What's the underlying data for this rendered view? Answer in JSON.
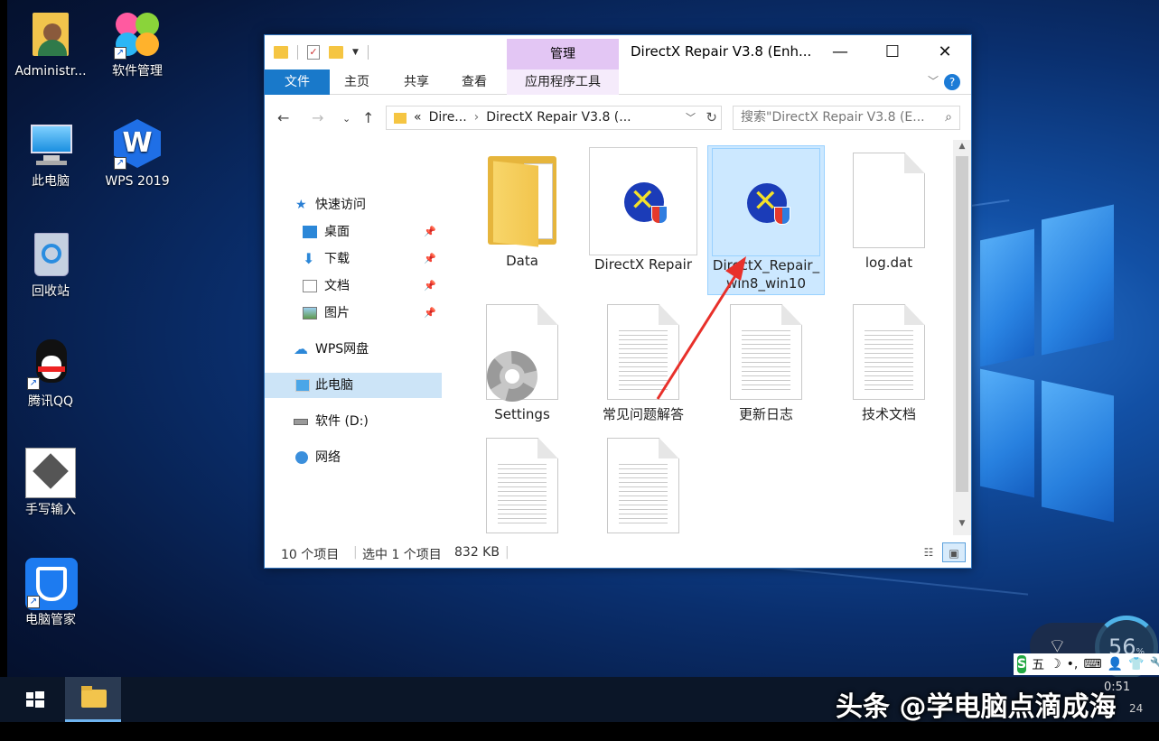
{
  "desktop": {
    "icons": [
      {
        "label": "Administr...",
        "icon": "user-folder-icon"
      },
      {
        "label": "软件管理",
        "icon": "software-manager-icon"
      },
      {
        "label": "此电脑",
        "icon": "computer-icon"
      },
      {
        "label": "WPS 2019",
        "icon": "wps-icon"
      },
      {
        "label": "回收站",
        "icon": "recycle-bin-icon"
      },
      {
        "label": "腾讯QQ",
        "icon": "qq-penguin-icon"
      },
      {
        "label": "手写输入",
        "icon": "handwriting-icon"
      },
      {
        "label": "电脑管家",
        "icon": "pc-manager-shield-icon"
      }
    ]
  },
  "window": {
    "title": "DirectX Repair V3.8 (Enh...",
    "contextual_group": "管理",
    "controls": {
      "minimize": "—",
      "maximize": "☐",
      "close": "✕"
    },
    "ribbon_tabs": [
      "文件",
      "主页",
      "共享",
      "查看",
      "应用程序工具"
    ],
    "address": {
      "prefix": "«",
      "segments": [
        "Dire...",
        "DirectX Repair V3.8 (..."
      ]
    },
    "search_placeholder": "搜索\"DirectX Repair V3.8 (E...",
    "nav": [
      {
        "label": "快速访问",
        "icon": "star-icon",
        "pinned": false
      },
      {
        "label": "桌面",
        "icon": "desktop-icon",
        "pinned": true
      },
      {
        "label": "下载",
        "icon": "download-arrow-icon",
        "pinned": true
      },
      {
        "label": "文档",
        "icon": "document-icon",
        "pinned": true
      },
      {
        "label": "图片",
        "icon": "pictures-icon",
        "pinned": true
      },
      {
        "label": "WPS网盘",
        "icon": "cloud-icon",
        "pinned": false
      },
      {
        "label": "此电脑",
        "icon": "computer-icon",
        "pinned": false,
        "selected": true
      },
      {
        "label": "软件 (D:)",
        "icon": "drive-icon",
        "pinned": false
      },
      {
        "label": "网络",
        "icon": "network-icon",
        "pinned": false
      }
    ],
    "files": [
      {
        "name": "Data",
        "type": "folder"
      },
      {
        "name": "DirectX Repair",
        "type": "app"
      },
      {
        "name": "DirectX_Repair_win8_win10",
        "line1": "DirectX_Repair_",
        "line2": "win8_win10",
        "type": "app",
        "selected": true
      },
      {
        "name": "log.dat",
        "type": "blank"
      },
      {
        "name": "Settings",
        "type": "settings"
      },
      {
        "name": "常见问题解答",
        "type": "text"
      },
      {
        "name": "更新日志",
        "type": "text"
      },
      {
        "name": "技术文档",
        "type": "text"
      },
      {
        "name": "",
        "type": "text"
      },
      {
        "name": "",
        "type": "text"
      }
    ],
    "status": {
      "count": "10 个项目",
      "selection": "选中 1 个项目",
      "size": "832 KB"
    }
  },
  "taskbar": {
    "watermark": "头条 @学电脑点滴成海",
    "clock": "0:51",
    "date": "24"
  },
  "tray": {
    "gauge_value": "56",
    "gauge_unit": "%",
    "ime": "五"
  }
}
